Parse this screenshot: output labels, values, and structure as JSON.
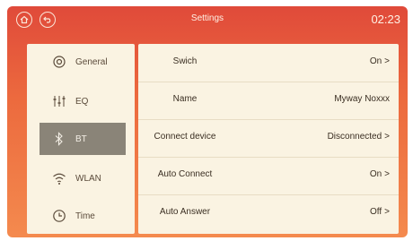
{
  "topbar": {
    "title": "Settings",
    "clock": "02:23",
    "home_icon": "home-icon",
    "back_icon": "back-icon"
  },
  "sidebar": {
    "items": [
      {
        "label": "General",
        "icon": "gear-icon",
        "active": false
      },
      {
        "label": "EQ",
        "icon": "equalizer-icon",
        "active": false
      },
      {
        "label": "BT",
        "icon": "bluetooth-icon",
        "active": true
      },
      {
        "label": "WLAN",
        "icon": "wifi-icon",
        "active": false
      },
      {
        "label": "Time",
        "icon": "clock-icon",
        "active": false
      }
    ]
  },
  "settings": {
    "rows": [
      {
        "label": "Swich",
        "value": "On",
        "arrow": ">"
      },
      {
        "label": "Name",
        "value": "Myway Noxxx",
        "arrow": ""
      },
      {
        "label": "Connect device",
        "value": "Disconnected",
        "arrow": ">"
      },
      {
        "label": "Auto Connect",
        "value": "On",
        "arrow": ">"
      },
      {
        "label": "Auto Answer",
        "value": "Off",
        "arrow": ">"
      }
    ]
  },
  "colors": {
    "header_start": "#e04a3a",
    "header_end": "#f48a4e",
    "panel_bg": "#faf3e2",
    "active_item": "#8a8478"
  }
}
